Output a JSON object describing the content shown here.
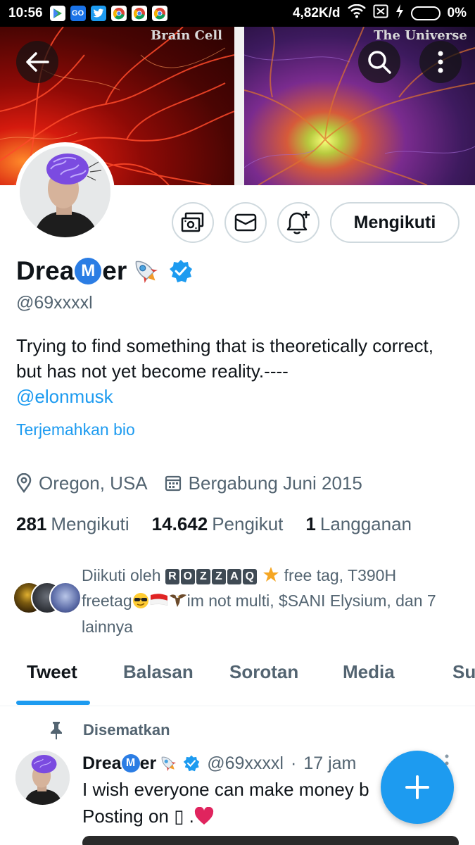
{
  "status_bar": {
    "time": "10:56",
    "net_speed": "4,82K/d",
    "battery": "0%",
    "apps": [
      "play-store",
      "go",
      "twitter",
      "chrome",
      "chrome",
      "chrome"
    ]
  },
  "banner": {
    "left_caption": "Brain Cell",
    "right_caption": "The Universe"
  },
  "profile": {
    "name_prefix": "Drea",
    "name_m": "M",
    "name_suffix": "er",
    "verified": true,
    "handle": "@69xxxxl",
    "bio": "Trying to find something that is theoretically correct, but has not yet become reality.----",
    "bio_mention": "@elonmusk",
    "translate_label": "Terjemahkan bio",
    "location": "Oregon, USA",
    "joined": "Bergabung Juni 2015",
    "follow_button": "Mengikuti"
  },
  "stats": {
    "following_count": "281",
    "following_label": "Mengikuti",
    "followers_count": "14.642",
    "followers_label": "Pengikut",
    "subs_count": "1",
    "subs_label": "Langganan"
  },
  "followed_by": {
    "prefix": "Diikuti oleh",
    "tag_letters": [
      "R",
      "O",
      "Z",
      "Z",
      "A",
      "Q"
    ],
    "line1_rest": "free tag, T390H",
    "line2_start": "freetag",
    "line2_rest": "im not multi, $SANI Elysium, dan 7",
    "line3": "lainnya"
  },
  "tabs": [
    "Tweet",
    "Balasan",
    "Sorotan",
    "Media",
    "Su"
  ],
  "active_tab": "Tweet",
  "tweet": {
    "pinned_label": "Disematkan",
    "name_prefix": "Drea",
    "name_m": "M",
    "name_suffix": "er",
    "handle": "@69xxxxl",
    "dot": "·",
    "time": "17 jam",
    "line1": "I wish everyone can make money b",
    "line2_text": "Posting on",
    "line2_glyph": "▯",
    "line2_end": ".",
    "heart": "❤️"
  },
  "colors": {
    "accent": "#1d9bf0",
    "text": "#0f1419",
    "muted": "#536471",
    "border": "#cfd9de"
  }
}
